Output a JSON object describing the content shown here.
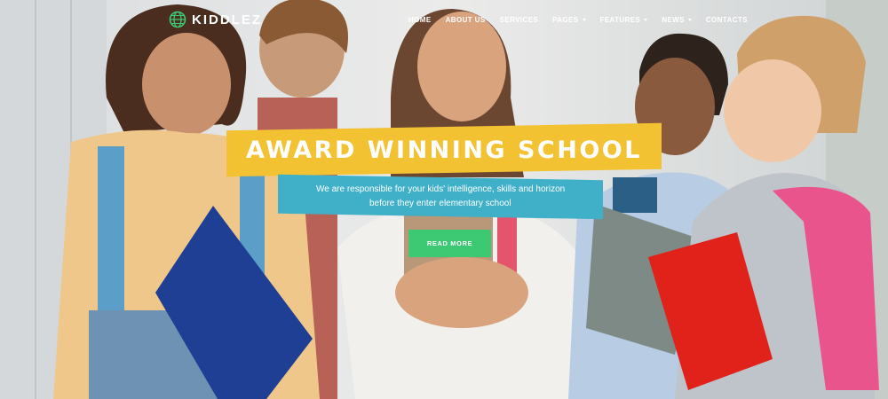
{
  "header": {
    "logo_text": "KIDDLEZ",
    "logo_icon": "globe-icon",
    "nav": [
      {
        "label": "HOME",
        "dropdown": false
      },
      {
        "label": "ABOUT US",
        "dropdown": false
      },
      {
        "label": "SERVICES",
        "dropdown": false
      },
      {
        "label": "PAGES",
        "dropdown": true
      },
      {
        "label": "FEATURES",
        "dropdown": true
      },
      {
        "label": "NEWS",
        "dropdown": true
      },
      {
        "label": "CONTACTS",
        "dropdown": false
      }
    ]
  },
  "hero": {
    "title": "AWARD WINNING SCHOOL",
    "subtitle_line1": "We are responsible for your kids' intelligence, skills and horizon",
    "subtitle_line2": "before they enter elementary school",
    "cta_label": "READ MORE"
  },
  "colors": {
    "title_band": "#f2c232",
    "subtitle_band": "#40b0c9",
    "cta": "#3dc873",
    "logo_icon": "#3dc873"
  }
}
